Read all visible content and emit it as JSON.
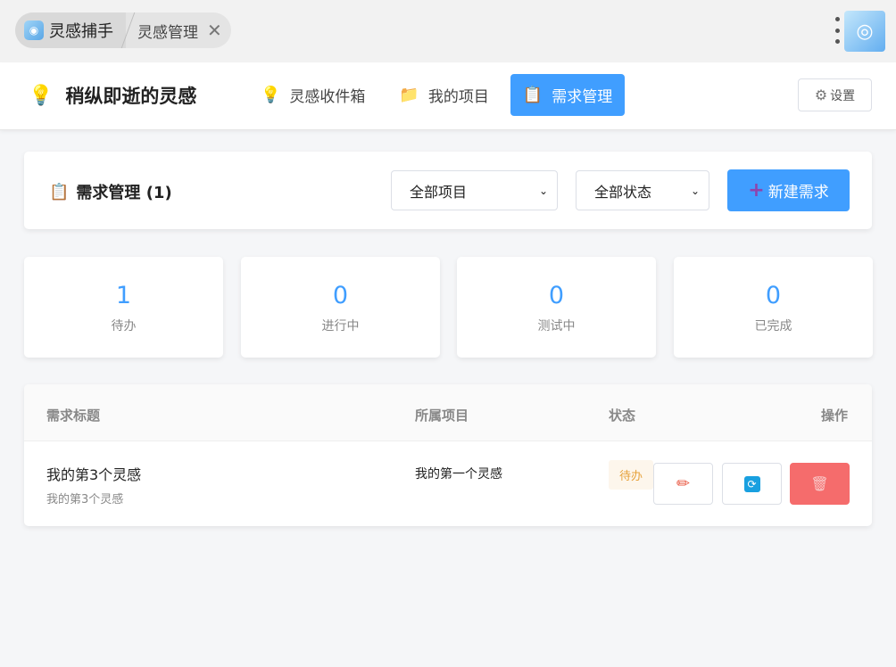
{
  "titlebar": {
    "app_tab_label": "灵感捕手",
    "page_tab_label": "灵感管理",
    "close_glyph": "✕"
  },
  "header": {
    "brand_title": "稍纵即逝的灵感",
    "nav": [
      {
        "label": "灵感收件箱",
        "icon": "lightbulb-icon",
        "active": false
      },
      {
        "label": "我的项目",
        "icon": "folder-icon",
        "active": false
      },
      {
        "label": "需求管理",
        "icon": "clipboard-icon",
        "active": true
      }
    ],
    "settings_label": "设置"
  },
  "requirements": {
    "title": "需求管理 (1)",
    "project_filter": "全部项目",
    "status_filter": "全部状态",
    "new_button_label": "新建需求"
  },
  "stats": [
    {
      "value": "1",
      "label": "待办"
    },
    {
      "value": "0",
      "label": "进行中"
    },
    {
      "value": "0",
      "label": "测试中"
    },
    {
      "value": "0",
      "label": "已完成"
    }
  ],
  "table": {
    "columns": [
      "需求标题",
      "所属项目",
      "状态",
      "操作"
    ],
    "rows": [
      {
        "title": "我的第3个灵感",
        "subtitle": "我的第3个灵感",
        "project": "我的第一个灵感",
        "status": "待办"
      }
    ]
  },
  "colors": {
    "accent": "#409eff",
    "danger": "#f56c6c",
    "warning": "#e6a23c"
  }
}
